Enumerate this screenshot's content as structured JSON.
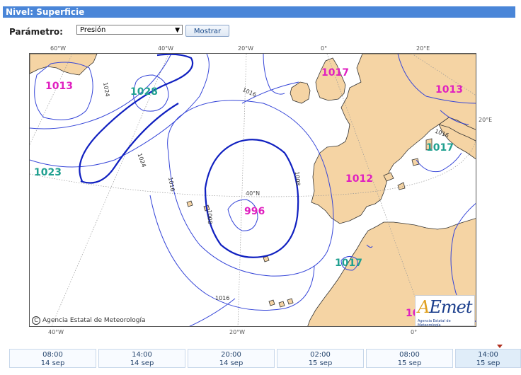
{
  "header": {
    "title": "Nivel: Superficie"
  },
  "param": {
    "label": "Parámetro:",
    "selected": "Presión",
    "button": "Mostrar"
  },
  "map": {
    "lon_labels_top": [
      "60°W",
      "40°W",
      "20°W",
      "0°",
      "20°E"
    ],
    "lon_labels_bottom": [
      "40°W",
      "20°W",
      "0°"
    ],
    "lat_labels": [
      "20°E",
      "40°N"
    ],
    "pressure_labels": [
      {
        "text": "1013",
        "color": "#e020c0"
      },
      {
        "text": "1028",
        "color": "#20a090"
      },
      {
        "text": "1017",
        "color": "#e020c0"
      },
      {
        "text": "1013",
        "color": "#e020c0"
      },
      {
        "text": "1023",
        "color": "#20a090"
      },
      {
        "text": "1017",
        "color": "#20a090"
      },
      {
        "text": "1012",
        "color": "#e020c0"
      },
      {
        "text": "996",
        "color": "#e020c0"
      },
      {
        "text": "1017",
        "color": "#20a090"
      },
      {
        "text": "10",
        "color": "#e020c0"
      }
    ],
    "isobar_labels": [
      "1024",
      "1016",
      "1024",
      "1016",
      "1008",
      "1008",
      "1016",
      "1016"
    ],
    "copyright": "Agencia Estatal de Meteorología",
    "logo": {
      "text_a": "A",
      "text_rest": "Emet",
      "sub": "Agencia Estatal de Meteorología"
    }
  },
  "timeline": [
    {
      "time": "08:00",
      "date": "14 sep"
    },
    {
      "time": "14:00",
      "date": "14 sep"
    },
    {
      "time": "20:00",
      "date": "14 sep"
    },
    {
      "time": "02:00",
      "date": "15 sep"
    },
    {
      "time": "08:00",
      "date": "15 sep"
    },
    {
      "time": "14:00",
      "date": "15 sep"
    }
  ]
}
